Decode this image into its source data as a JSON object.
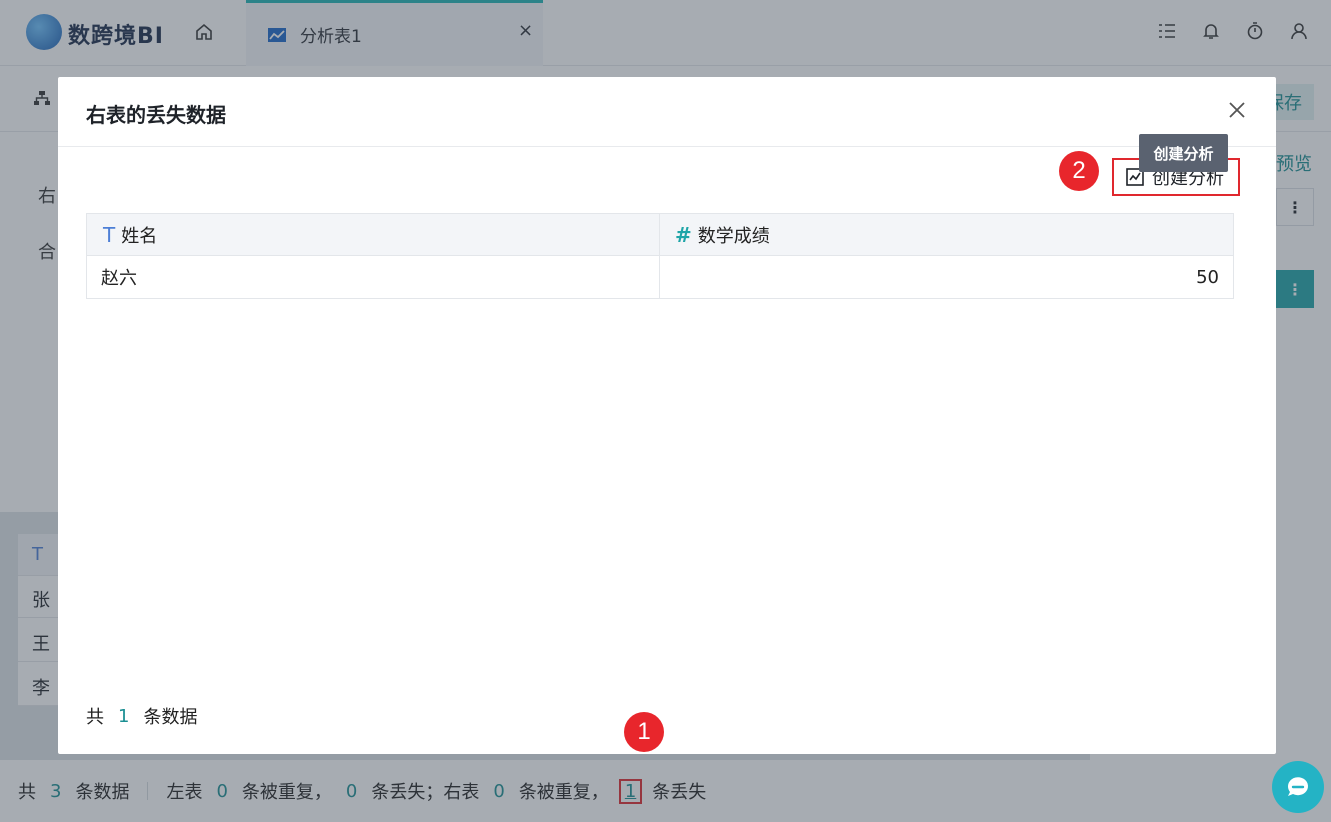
{
  "app": {
    "title": "数跨境BI"
  },
  "tab": {
    "label": "分析表1",
    "close": "×"
  },
  "toolbar": {
    "save": "保存",
    "preview": "预览"
  },
  "left_panel": {
    "item1": "右",
    "item2": "合"
  },
  "bg_table": {
    "rows": [
      "张",
      "王",
      "李"
    ]
  },
  "footer": {
    "total_prefix": "共",
    "total": "3",
    "total_suffix": "条数据",
    "left_label": "左表",
    "left_dup": "0",
    "dup_text": "条被重复，",
    "left_lost": "0",
    "lost_text1": "条丢失；",
    "right_label": "右表",
    "right_dup": "0",
    "dup_text2": "条被重复，",
    "right_lost": "1",
    "lost_text2": "条丢失"
  },
  "modal": {
    "title": "右表的丢失数据",
    "create_label": "创建分析",
    "tooltip": "创建分析",
    "columns": [
      {
        "icon": "T",
        "name": "姓名"
      },
      {
        "icon": "#",
        "name": "数学成绩"
      }
    ],
    "rows": [
      {
        "name": "赵六",
        "score": "50"
      }
    ],
    "footer_prefix": "共",
    "count": "1",
    "footer_suffix": "条数据"
  },
  "annotations": {
    "badge1": "1",
    "badge2": "2"
  },
  "colors": {
    "accent": "#1fa5a8",
    "highlight": "#e0282e",
    "badge": "#e8262c"
  },
  "icons": [
    "logo-icon",
    "home-icon",
    "chart-icon",
    "task-list-icon",
    "bell-icon",
    "timer-icon",
    "user-icon",
    "close-icon",
    "create-analysis-icon",
    "text-type-icon",
    "number-type-icon",
    "chat-icon"
  ]
}
